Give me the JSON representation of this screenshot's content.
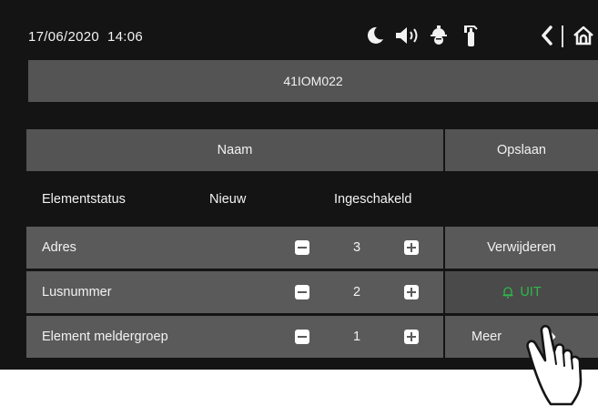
{
  "status_bar": {
    "date": "17/06/2020",
    "time": "14:06",
    "icons": [
      "moon-icon",
      "speaker-icon",
      "fire-service-icon",
      "fire-extinguisher-icon",
      "back-icon",
      "home-icon"
    ]
  },
  "device": {
    "id": "41IOM022"
  },
  "actions": {
    "name_label": "Naam",
    "save_label": "Opslaan"
  },
  "element_status": {
    "label": "Elementstatus",
    "state": "Nieuw",
    "enabled": "Ingeschakeld",
    "enabled_color": "#2fb84a"
  },
  "parameters": [
    {
      "label": "Adres",
      "value": "3"
    },
    {
      "label": "Lusnummer",
      "value": "2"
    },
    {
      "label": "Element meldergroep",
      "value": "1"
    }
  ],
  "side_buttons": {
    "delete_label": "Verwijderen",
    "off_label": "UIT",
    "more_label": "Meer"
  }
}
